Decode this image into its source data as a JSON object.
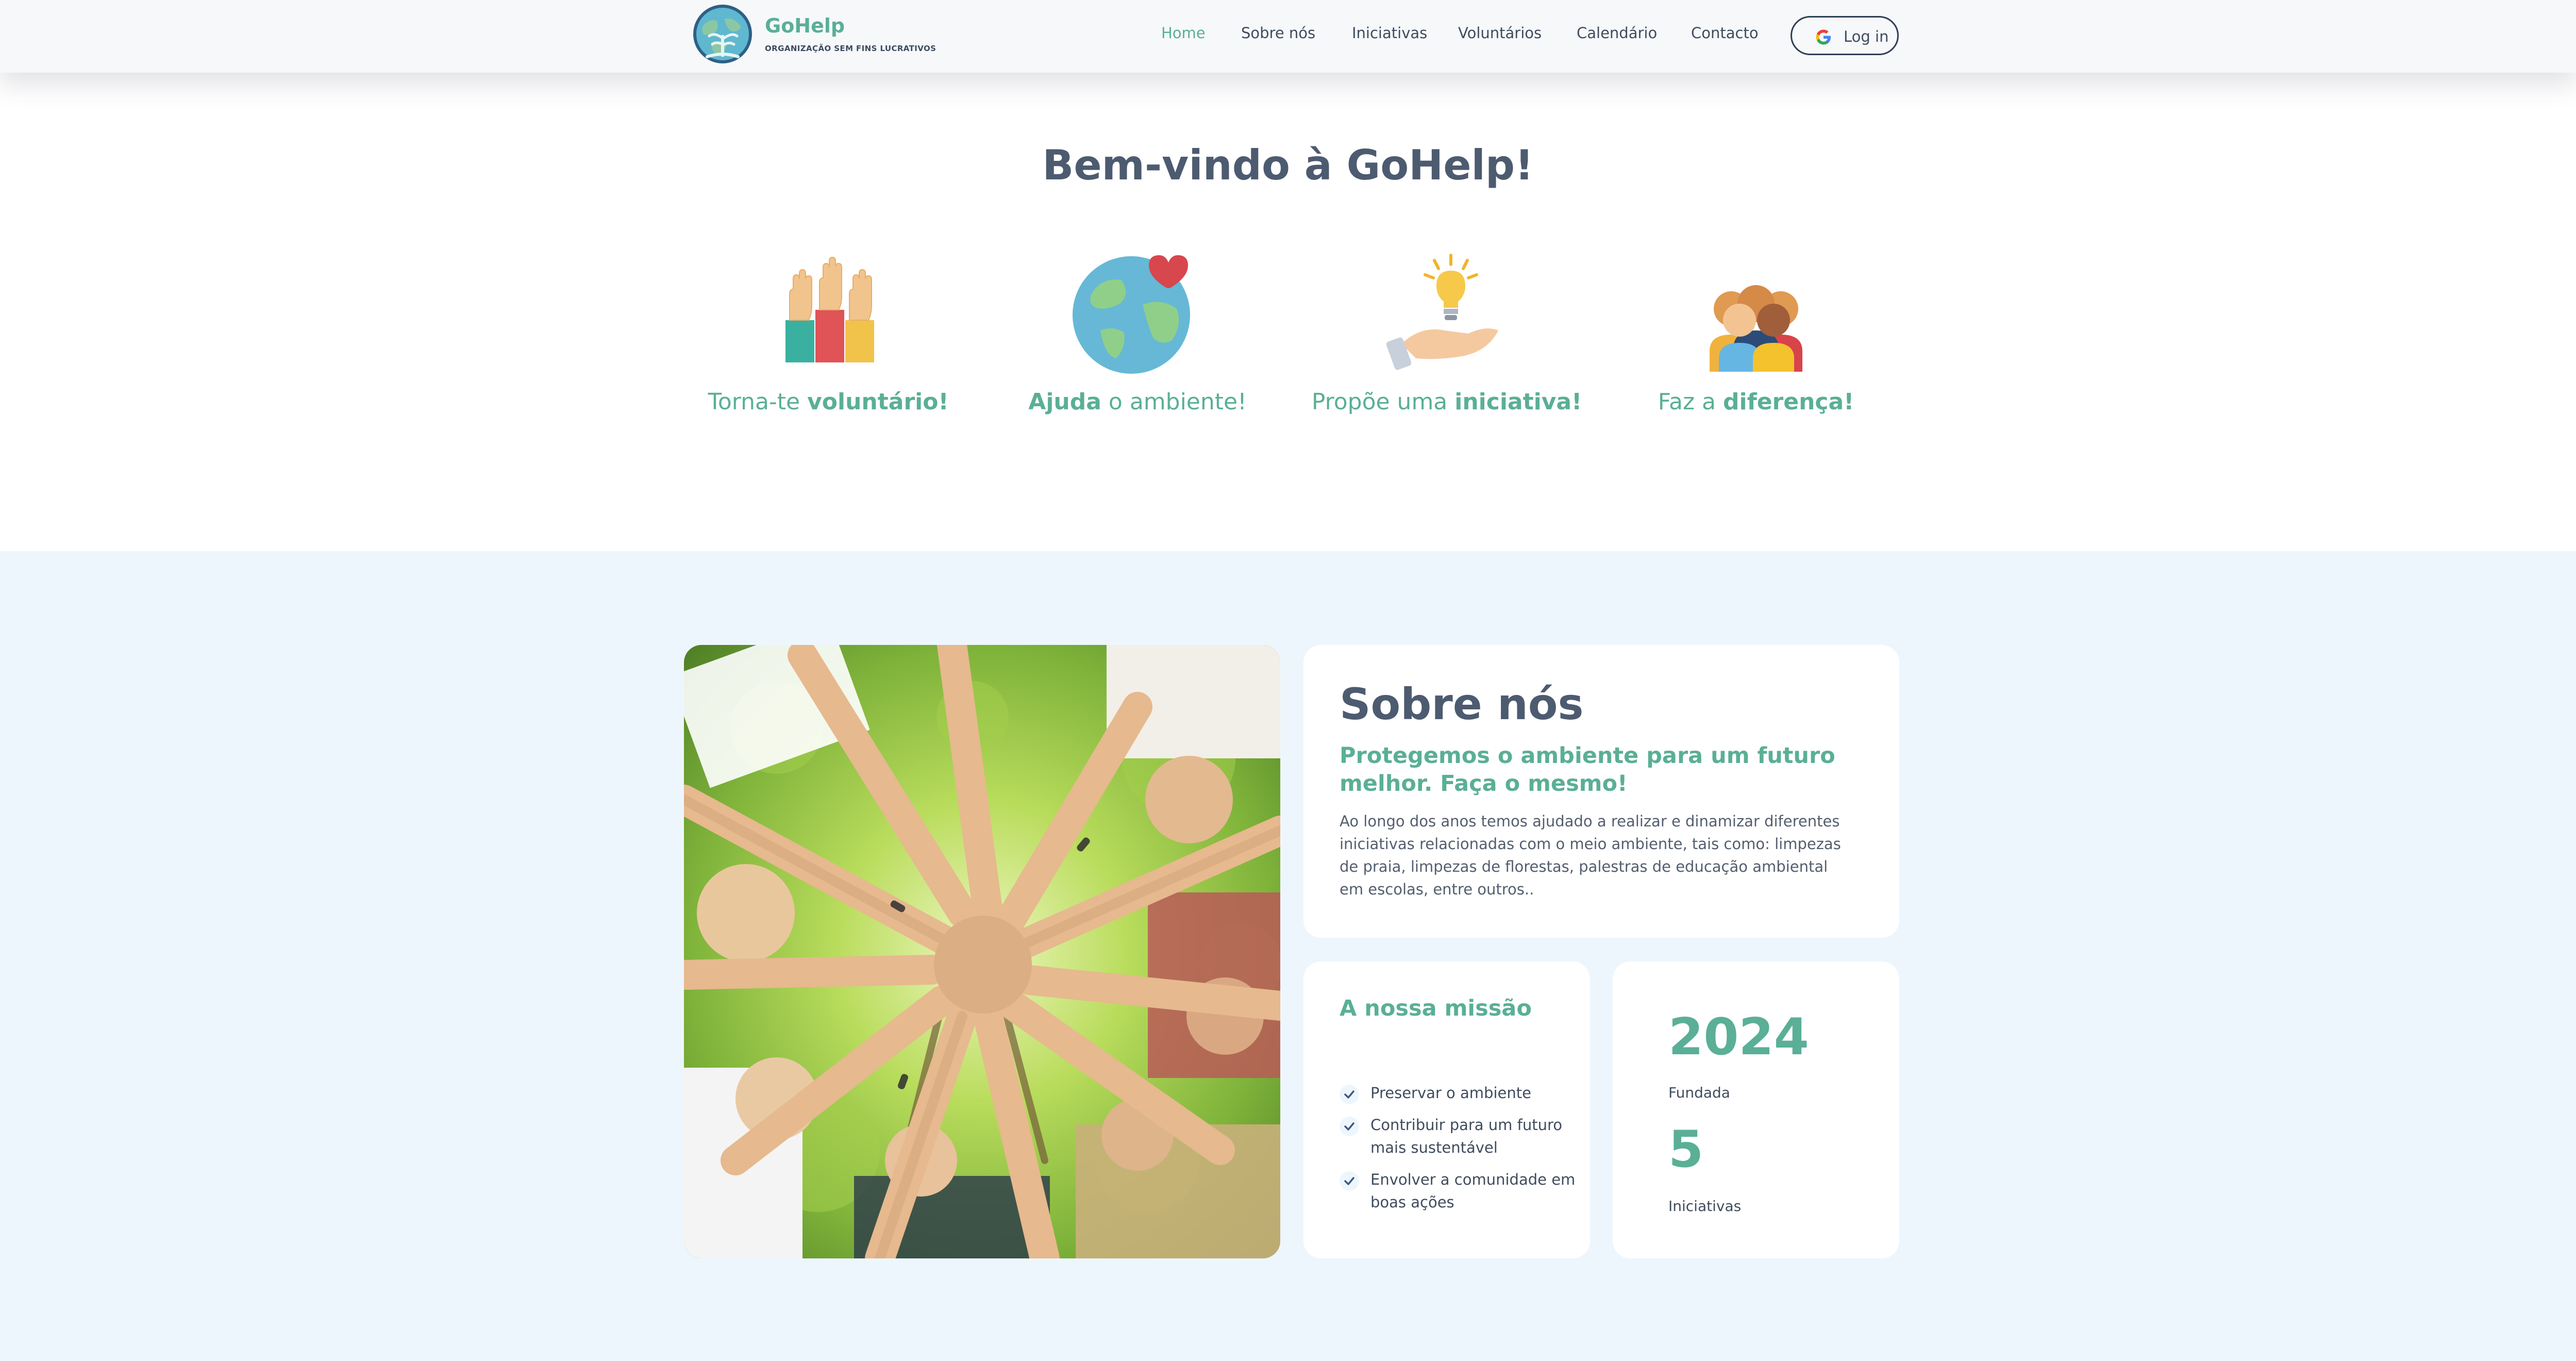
{
  "brand": {
    "name": "GoHelp",
    "tagline": "ORGANIZAÇÃO SEM FINS LUCRATIVOS",
    "logo_icon": "globe-tree-logo-icon"
  },
  "nav": {
    "items": [
      {
        "label": "Home",
        "active": true
      },
      {
        "label": "Sobre nós",
        "active": false
      },
      {
        "label": "Iniciativas",
        "active": false
      },
      {
        "label": "Voluntários",
        "active": false
      },
      {
        "label": "Calendário",
        "active": false
      },
      {
        "label": "Contacto",
        "active": false
      }
    ],
    "login_label": "Log in",
    "login_icon": "google-icon"
  },
  "hero": {
    "title": "Bem-vindo à GoHelp!",
    "features": [
      {
        "icon": "raised-hands-icon",
        "pre": "Torna-te ",
        "bold": "voluntário!",
        "post": ""
      },
      {
        "icon": "earth-heart-icon",
        "pre": "",
        "bold": "Ajuda",
        "post": " o ambiente!"
      },
      {
        "icon": "lightbulb-hand-icon",
        "pre": "Propõe uma ",
        "bold": "iniciativa!",
        "post": ""
      },
      {
        "icon": "people-group-icon",
        "pre": "Faz a ",
        "bold": "diferença!",
        "post": ""
      }
    ]
  },
  "about": {
    "photo_icon": "volunteers-joined-hands-photo",
    "title": "Sobre nós",
    "subtitle": "Protegemos o ambiente para um futuro melhor. Faça o mesmo!",
    "body": "Ao longo dos anos temos ajudado a realizar e dinamizar diferentes iniciativas relacionadas com o meio ambiente, tais como: limpezas de praia, limpezas de florestas, palestras de educação ambiental em escolas, entre outros..",
    "mission": {
      "title": "A nossa missão",
      "items": [
        "Preservar o ambiente",
        "Contribuir para um futuro mais sustentável",
        "Envolver a comunidade em boas ações"
      ]
    },
    "stats": [
      {
        "value": "2024",
        "label": "Fundada"
      },
      {
        "value": "5",
        "label": "Iniciativas"
      }
    ]
  },
  "colors": {
    "accent": "#5aaf96",
    "heading": "#4d5b70",
    "section_bg": "#eef6fd",
    "header_bg": "#f6f8fa"
  }
}
